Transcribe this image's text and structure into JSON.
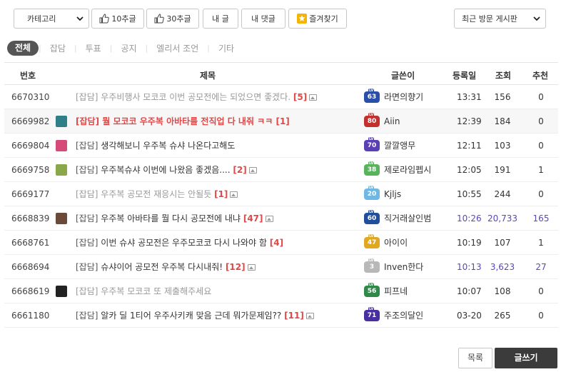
{
  "toolbar": {
    "category_label": "카테고리",
    "upvote10_label": "10추글",
    "upvote30_label": "30추글",
    "my_posts_label": "내 글",
    "my_comments_label": "내 댓글",
    "favorites_label": "즐겨찾기",
    "recent_boards_label": "최근 방문 게시판"
  },
  "tabs": {
    "all": "전체",
    "items": [
      "잡담",
      "투표",
      "공지",
      "엘리서 조언",
      "기타"
    ]
  },
  "table": {
    "headers": {
      "no": "번호",
      "title": "제목",
      "author": "글쓴이",
      "date": "등록일",
      "views": "조회",
      "rec": "추천"
    },
    "rows": [
      {
        "no": "6670310",
        "cat": "[잡담]",
        "title": "우주비행사 모코코 이번 공모전에는 되었으면 좋겠다.",
        "comments": "[5]",
        "img": true,
        "style": "grey",
        "level": "63",
        "level_color": "#2a4fa8",
        "author": "라면의향기",
        "date": "13:31",
        "views": "156",
        "rec": "0",
        "highlight": false,
        "date_purple": false,
        "icon": null
      },
      {
        "no": "6669982",
        "cat": "[잡담]",
        "title": "뭘 모코코 우주복 아바타를 전직업 다 내줘 ㅋㅋ",
        "comments": "[1]",
        "img": false,
        "style": "red",
        "level": "80",
        "level_color": "#c23030",
        "author": "Aiin",
        "date": "12:39",
        "views": "184",
        "rec": "0",
        "highlight": true,
        "date_purple": false,
        "icon": "#2f7f8a"
      },
      {
        "no": "6669804",
        "cat": "[잡담]",
        "title": "생각해보니 우주복 슈샤 나온다고해도",
        "comments": "",
        "img": false,
        "style": "normal",
        "level": "70",
        "level_color": "#5b3fb5",
        "author": "깔깔앵무",
        "date": "12:11",
        "views": "103",
        "rec": "0",
        "highlight": false,
        "date_purple": false,
        "icon": "#d64a7a"
      },
      {
        "no": "6669758",
        "cat": "[잡담]",
        "title": "우주복슈샤 이번에 나왔음 좋겠음....",
        "comments": "[2]",
        "img": true,
        "style": "normal",
        "level": "38",
        "level_color": "#58b35a",
        "author": "제로라임펩시",
        "date": "12:05",
        "views": "191",
        "rec": "1",
        "highlight": false,
        "date_purple": false,
        "icon": "#8aa84a"
      },
      {
        "no": "6669177",
        "cat": "[잡담]",
        "title": "우주복 공모전 재응시는 안될듯",
        "comments": "[1]",
        "img": true,
        "style": "grey",
        "level": "20",
        "level_color": "#6fb8e6",
        "author": "Kjljs",
        "date": "10:55",
        "views": "244",
        "rec": "0",
        "highlight": false,
        "date_purple": false,
        "icon": null
      },
      {
        "no": "6668839",
        "cat": "[잡담]",
        "title": "우주복 아바타를 뭘 다시 공모전에 내냐",
        "comments": "[47]",
        "img": true,
        "style": "normal",
        "level": "60",
        "level_color": "#1f4e9c",
        "author": "직거래살인범",
        "date": "10:26",
        "views": "20,733",
        "rec": "165",
        "highlight": false,
        "date_purple": true,
        "icon": "#6b4a3a"
      },
      {
        "no": "6668761",
        "cat": "[잡담]",
        "title": "이번 슈샤 공모전은 우주모코코 다시 나와야 함",
        "comments": "[4]",
        "img": false,
        "style": "normal",
        "level": "47",
        "level_color": "#e0a820",
        "author": "아이이",
        "date": "10:19",
        "views": "107",
        "rec": "1",
        "highlight": false,
        "date_purple": false,
        "icon": null
      },
      {
        "no": "6668694",
        "cat": "[잡담]",
        "title": "슈샤이어 공모전 우주복 다시내줘!",
        "comments": "[12]",
        "img": true,
        "style": "normal",
        "level": "3",
        "level_color": "#b8b8b8",
        "author": "Inven한다",
        "date": "10:13",
        "views": "3,623",
        "rec": "27",
        "highlight": false,
        "date_purple": true,
        "icon": null
      },
      {
        "no": "6668619",
        "cat": "[잡담]",
        "title": "우주복 모코코 또 제출해주세요",
        "comments": "",
        "img": false,
        "style": "grey",
        "level": "56",
        "level_color": "#2f8a4a",
        "author": "피프네",
        "date": "10:07",
        "views": "108",
        "rec": "0",
        "highlight": false,
        "date_purple": false,
        "icon": "#222222"
      },
      {
        "no": "6661180",
        "cat": "[잡담]",
        "title": "알카 딜 1티어 우주사키캐 맞음 근데 뭐가문제임??",
        "comments": "[11]",
        "img": true,
        "style": "normal",
        "level": "71",
        "level_color": "#4a2fa0",
        "author": "주조의달인",
        "date": "03-20",
        "views": "265",
        "rec": "0",
        "highlight": false,
        "date_purple": false,
        "icon": null
      }
    ]
  },
  "footer": {
    "list_label": "목록",
    "write_label": "글쓰기"
  },
  "colors": {
    "accent_red": "#e04848",
    "purple": "#5a48b8",
    "tab_active_bg": "#555555",
    "write_btn_bg": "#3b3b3b"
  }
}
